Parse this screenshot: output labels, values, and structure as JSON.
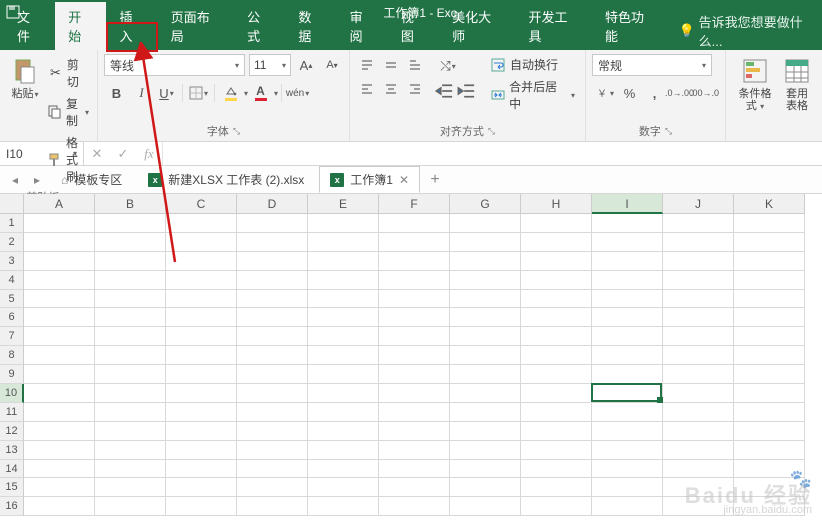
{
  "titlebar": {
    "title": "工作簿1 - Exc"
  },
  "menu": {
    "tabs": [
      "文件",
      "开始",
      "插入",
      "页面布局",
      "公式",
      "数据",
      "审阅",
      "视图",
      "美化大师",
      "开发工具",
      "特色功能"
    ],
    "active_index": 1,
    "tell_me": "告诉我您想要做什么..."
  },
  "ribbon": {
    "clipboard": {
      "paste": "粘贴",
      "cut": "剪切",
      "copy": "复制",
      "format_painter": "格式刷",
      "group_label": "剪贴板"
    },
    "font": {
      "font_name": "等线",
      "font_size": "11",
      "group_label": "字体",
      "bold": "B",
      "italic": "I",
      "underline": "U",
      "wen": "wén"
    },
    "alignment": {
      "wrap": "自动换行",
      "merge": "合并后居中",
      "group_label": "对齐方式"
    },
    "number": {
      "format": "常规",
      "group_label": "数字",
      "percent": "%",
      "comma": ","
    },
    "styles": {
      "cond_format": "条件格式",
      "cell_styles": "套用\n表格"
    }
  },
  "formula_bar": {
    "name_box": "I10",
    "fx": "fx",
    "value": ""
  },
  "doc_tabs": {
    "template": "模板专区",
    "tab1": "新建XLSX 工作表 (2).xlsx",
    "tab2": "工作簿1"
  },
  "grid": {
    "columns": [
      "A",
      "B",
      "C",
      "D",
      "E",
      "F",
      "G",
      "H",
      "I",
      "J",
      "K"
    ],
    "rows": [
      "1",
      "2",
      "3",
      "4",
      "5",
      "6",
      "7",
      "8",
      "9",
      "10",
      "11",
      "12",
      "13",
      "14",
      "15",
      "16"
    ],
    "selected": {
      "col_index": 8,
      "row_index": 9,
      "ref": "I10"
    }
  },
  "watermark": {
    "brand": "Baidu 经验",
    "url": "jingyan.baidu.com"
  }
}
